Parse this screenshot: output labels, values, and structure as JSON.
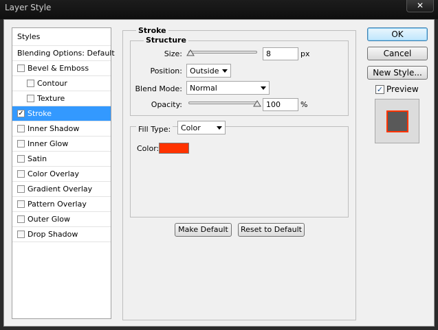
{
  "window": {
    "title": "Layer Style",
    "close_glyph": "✕"
  },
  "styles_list": {
    "header": "Styles",
    "blending_options": "Blending Options: Default",
    "items": [
      {
        "label": "Bevel & Emboss",
        "checked": false,
        "indent": 0
      },
      {
        "label": "Contour",
        "checked": false,
        "indent": 1
      },
      {
        "label": "Texture",
        "checked": false,
        "indent": 1
      },
      {
        "label": "Stroke",
        "checked": true,
        "indent": 0,
        "selected": true
      },
      {
        "label": "Inner Shadow",
        "checked": false,
        "indent": 0
      },
      {
        "label": "Inner Glow",
        "checked": false,
        "indent": 0
      },
      {
        "label": "Satin",
        "checked": false,
        "indent": 0
      },
      {
        "label": "Color Overlay",
        "checked": false,
        "indent": 0
      },
      {
        "label": "Gradient Overlay",
        "checked": false,
        "indent": 0
      },
      {
        "label": "Pattern Overlay",
        "checked": false,
        "indent": 0
      },
      {
        "label": "Outer Glow",
        "checked": false,
        "indent": 0
      },
      {
        "label": "Drop Shadow",
        "checked": false,
        "indent": 0
      }
    ]
  },
  "stroke": {
    "section_title": "Stroke",
    "structure_title": "Structure",
    "size": {
      "label": "Size:",
      "value": "8",
      "unit": "px",
      "slider_level": 0.03
    },
    "position": {
      "label": "Position:",
      "value": "Outside"
    },
    "blend_mode": {
      "label": "Blend Mode:",
      "value": "Normal"
    },
    "opacity": {
      "label": "Opacity:",
      "value": "100",
      "unit": "%",
      "slider_level": 1.0
    },
    "fill_type": {
      "label": "Fill Type:",
      "value": "Color"
    },
    "color": {
      "label": "Color:",
      "hex": "#ff3300"
    },
    "make_default": "Make Default",
    "reset_default": "Reset to Default"
  },
  "actions": {
    "ok": "OK",
    "cancel": "Cancel",
    "new_style": "New Style...",
    "preview_label": "Preview",
    "preview_checked": true,
    "preview_fill": "#595959",
    "preview_stroke": "#ff3300"
  },
  "colors": {
    "selection": "#3399ff",
    "accent": "#ff3300"
  }
}
